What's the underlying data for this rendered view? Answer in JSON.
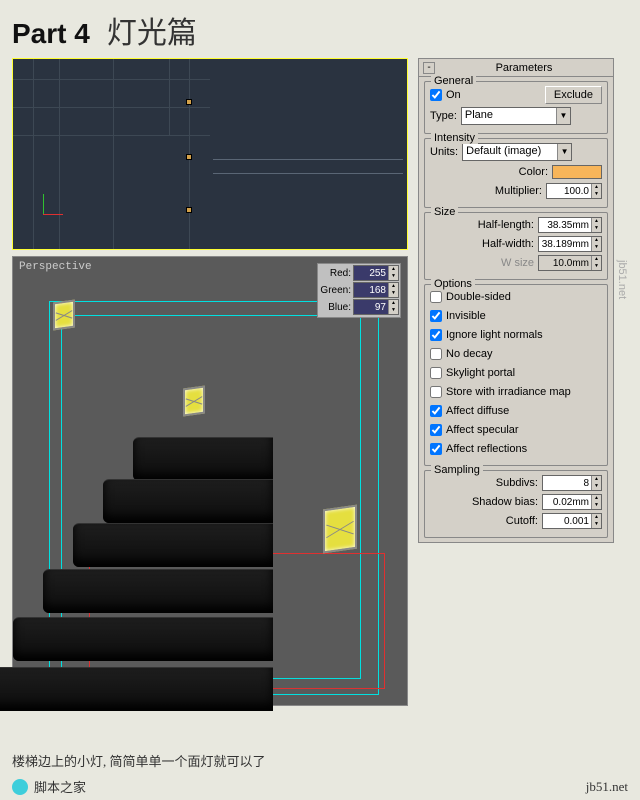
{
  "header": {
    "part": "Part 4",
    "title_cn": "灯光篇"
  },
  "viewport": {
    "label": "Perspective"
  },
  "rgb": {
    "red_label": "Red:",
    "red": "255",
    "green_label": "Green:",
    "green": "168",
    "blue_label": "Blue:",
    "blue": "97"
  },
  "parameters": {
    "rollup_title": "Parameters",
    "general": {
      "legend": "General",
      "on_label": "On",
      "exclude_btn": "Exclude",
      "type_label": "Type:",
      "type_value": "Plane"
    },
    "intensity": {
      "legend": "Intensity",
      "units_label": "Units:",
      "units_value": "Default (image)",
      "color_label": "Color:",
      "color_hex": "#f7b55a",
      "multiplier_label": "Multiplier:",
      "multiplier": "100.0"
    },
    "size": {
      "legend": "Size",
      "half_length_label": "Half-length:",
      "half_length": "38.35mm",
      "half_width_label": "Half-width:",
      "half_width": "38.189mm",
      "w_size_label": "W size",
      "w_size": "10.0mm"
    },
    "options": {
      "legend": "Options",
      "items": [
        {
          "label": "Double-sided",
          "checked": false
        },
        {
          "label": "Invisible",
          "checked": true
        },
        {
          "label": "Ignore light normals",
          "checked": true
        },
        {
          "label": "No decay",
          "checked": false
        },
        {
          "label": "Skylight portal",
          "checked": false
        },
        {
          "label": "Store with irradiance map",
          "checked": false
        },
        {
          "label": "Affect diffuse",
          "checked": true
        },
        {
          "label": "Affect specular",
          "checked": true
        },
        {
          "label": "Affect reflections",
          "checked": true
        }
      ]
    },
    "sampling": {
      "legend": "Sampling",
      "subdivs_label": "Subdivs:",
      "subdivs": "8",
      "shadow_bias_label": "Shadow bias:",
      "shadow_bias": "0.02mm",
      "cutoff_label": "Cutoff:",
      "cutoff": "0.001"
    }
  },
  "caption": "楼梯边上的小灯, 简简单单一个面灯就可以了",
  "footer": {
    "site_cn": "脚本之家",
    "url": "jb51.net"
  }
}
